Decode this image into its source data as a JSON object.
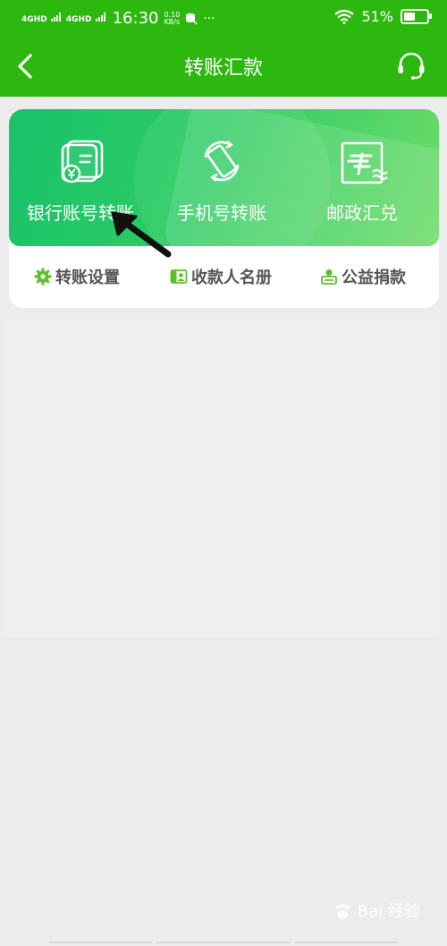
{
  "status_bar": {
    "signal1": "4GHD",
    "signal2": "4GHD",
    "time": "16:30",
    "net_speed_value": "0.10",
    "net_speed_unit": "KB/s",
    "more": "···",
    "battery_text": "51%",
    "battery_level": 0.51
  },
  "header": {
    "title": "转账汇款",
    "back_icon": "chevron-left-icon",
    "service_icon": "headset-icon"
  },
  "functions": [
    {
      "label": "银行账号转账",
      "icon": "bank-card-icon"
    },
    {
      "label": "手机号转账",
      "icon": "phone-rotate-icon"
    },
    {
      "label": "邮政汇兑",
      "icon": "postal-icon"
    }
  ],
  "quick_links": [
    {
      "label": "转账设置",
      "icon": "gear-icon"
    },
    {
      "label": "收款人名册",
      "icon": "contact-card-icon"
    },
    {
      "label": "公益捐款",
      "icon": "donation-icon"
    }
  ],
  "watermark": {
    "text": "Bai 经验"
  },
  "colors": {
    "primary_green": "#2db810",
    "banner_green": "#2dcc63",
    "background": "#ebeceb",
    "quick_icon_green": "#5cbf2a"
  }
}
